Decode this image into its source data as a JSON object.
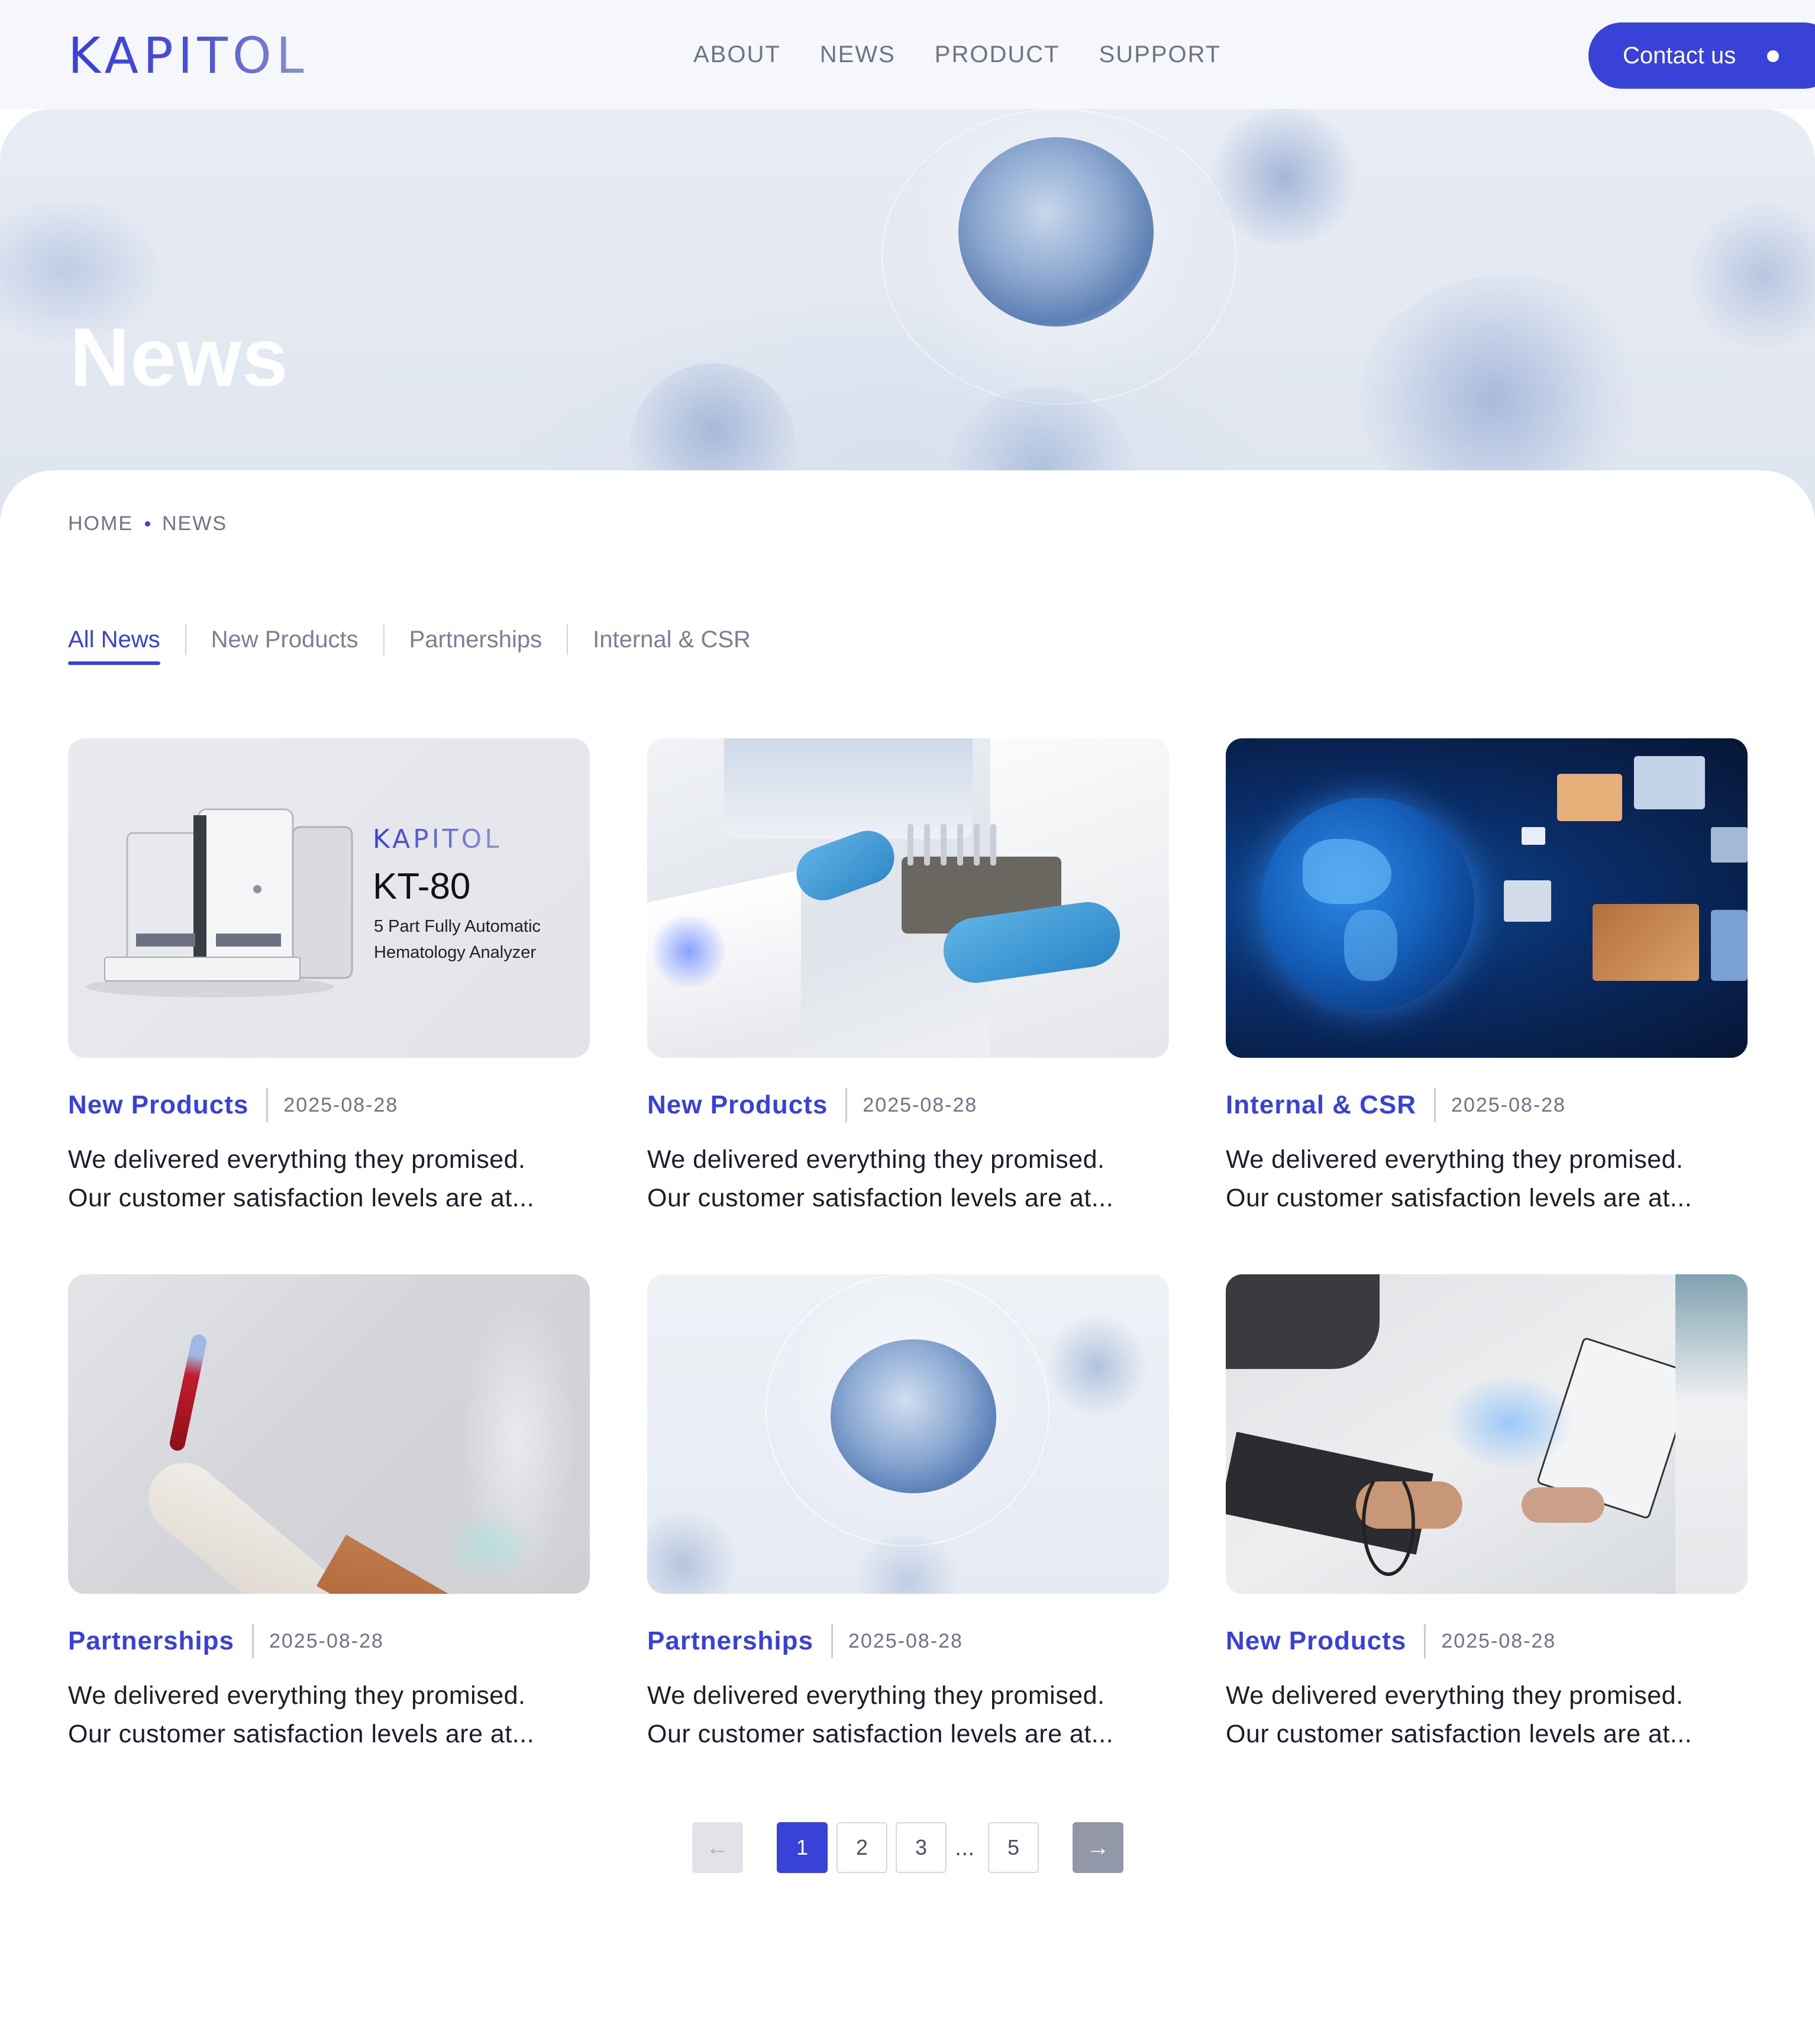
{
  "header": {
    "logo": "KAPITOL",
    "nav": [
      "ABOUT",
      "NEWS",
      "PRODUCT",
      "SUPPORT"
    ],
    "contact_label": "Contact us"
  },
  "hero": {
    "title": "News"
  },
  "breadcrumb": {
    "home": "HOME",
    "current": "NEWS"
  },
  "tabs": [
    "All News",
    "New Products",
    "Partnerships",
    "Internal & CSR"
  ],
  "cards": [
    {
      "category": "New Products",
      "date": "2025-08-28",
      "line1": "We delivered everything they promised.",
      "line2": "Our customer satisfaction levels are at...",
      "image": {
        "brand": "KAPITOL",
        "model": "KT-80",
        "desc1": "5 Part Fully Automatic",
        "desc2": "Hematology Analyzer"
      }
    },
    {
      "category": "New Products",
      "date": "2025-08-28",
      "line1": "We delivered everything they promised.",
      "line2": "Our customer satisfaction levels are at..."
    },
    {
      "category": "Internal & CSR",
      "date": "2025-08-28",
      "line1": "We delivered everything they promised.",
      "line2": "Our customer satisfaction levels are at..."
    },
    {
      "category": "Partnerships",
      "date": "2025-08-28",
      "line1": "We delivered everything they promised.",
      "line2": "Our customer satisfaction levels are at..."
    },
    {
      "category": "Partnerships",
      "date": "2025-08-28",
      "line1": "We delivered everything they promised.",
      "line2": "Our customer satisfaction levels are at..."
    },
    {
      "category": "New Products",
      "date": "2025-08-28",
      "line1": "We delivered everything they promised.",
      "line2": "Our customer satisfaction levels are at..."
    }
  ],
  "pagination": {
    "pages": [
      "1",
      "2",
      "3",
      "5"
    ],
    "ellipsis": "...",
    "current": "1",
    "prev_icon": "←",
    "next_icon": "→"
  },
  "colors": {
    "accent": "#3942d8",
    "text": "#1a1d2b",
    "muted": "#6e7388"
  }
}
